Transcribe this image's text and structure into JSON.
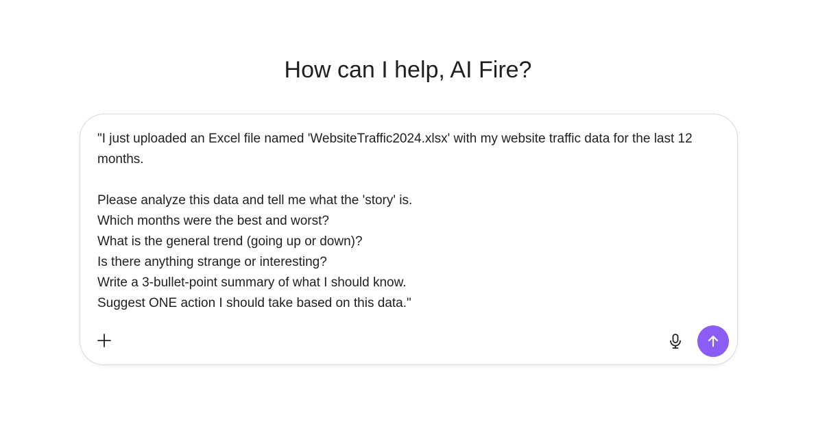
{
  "header": {
    "title": "How can I help, AI Fire?"
  },
  "composer": {
    "lines": [
      "\"I just uploaded an Excel file named 'WebsiteTraffic2024.xlsx' with my website traffic data for the last 12",
      "months.",
      "",
      "Please analyze this data and tell me what the 'story' is.",
      "Which months were the best and worst?",
      "What is the general trend (going up or down)?",
      "Is there anything strange or interesting?",
      "Write a 3-bullet-point summary of what I should know.",
      "Suggest ONE action I should take based on this data.\""
    ],
    "icons": {
      "add": "plus-icon",
      "mic": "microphone-icon",
      "send": "arrow-up-icon"
    },
    "accent_color": "#8b5cf6"
  }
}
